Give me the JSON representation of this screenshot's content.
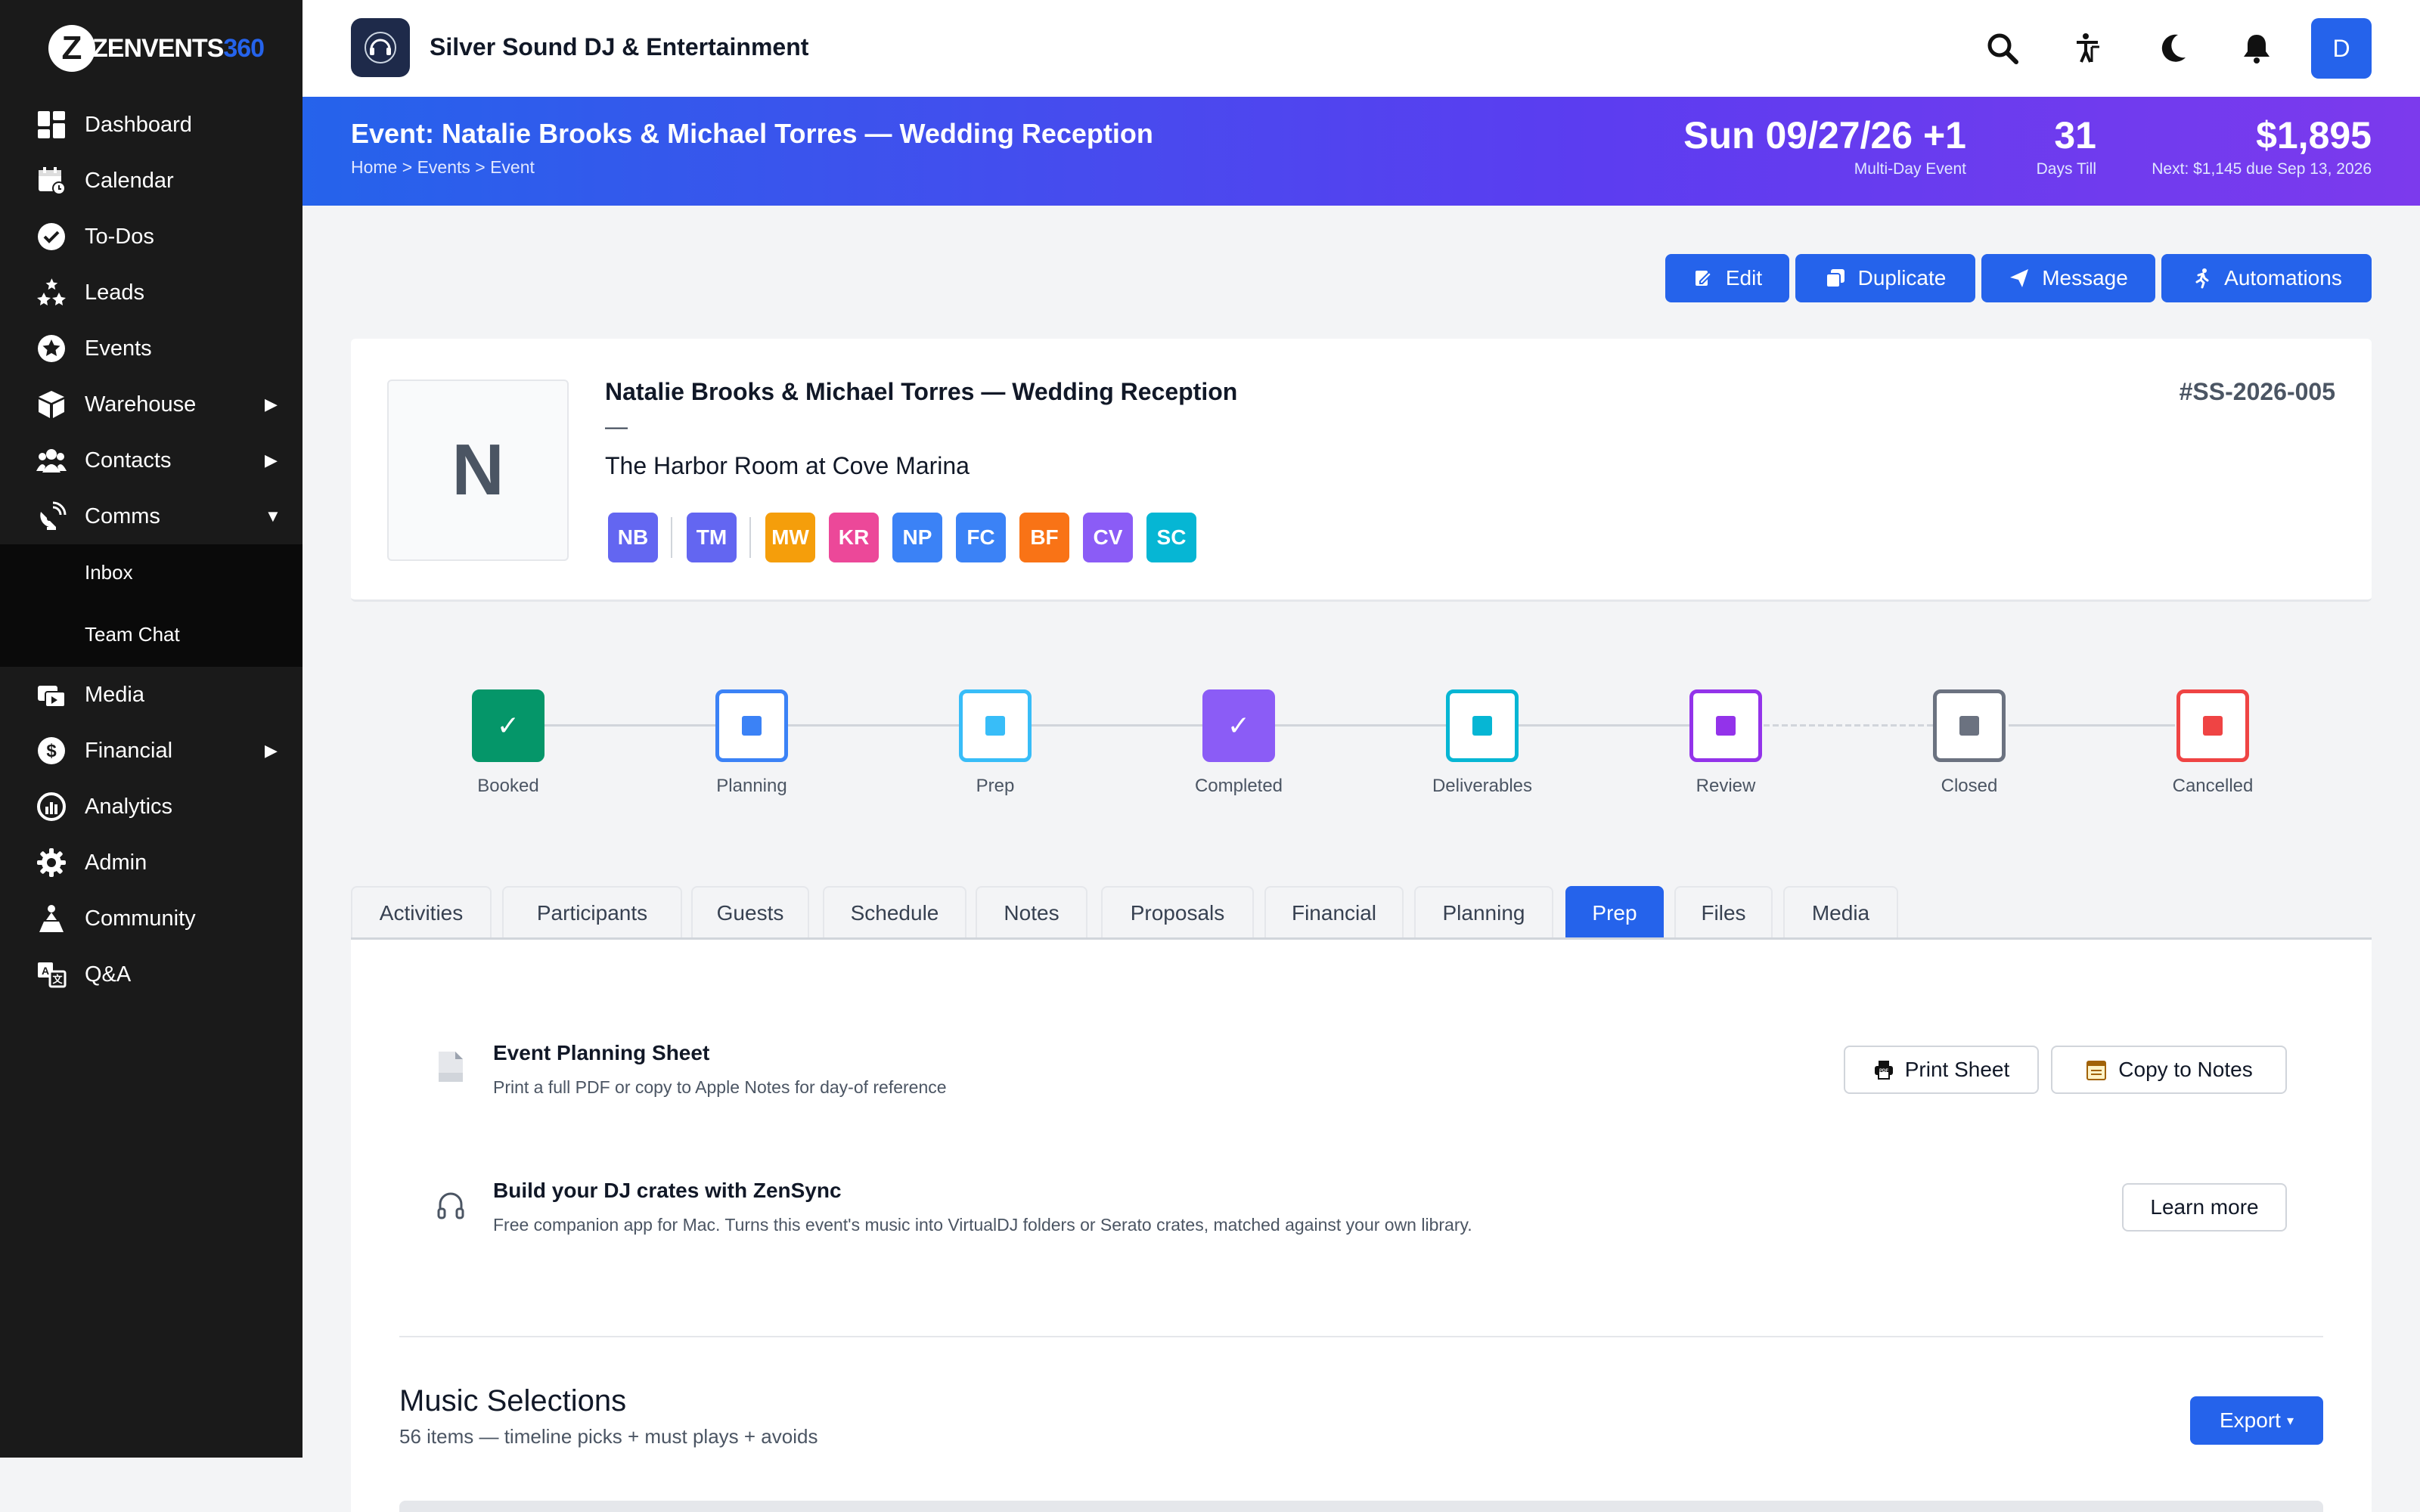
{
  "app": {
    "logo_letter": "Z",
    "logo_text": "ZENVENTS",
    "logo_accent": "360",
    "accent_color": "#2563eb"
  },
  "sidebar": {
    "items": [
      {
        "label": "Dashboard",
        "icon": "dashboard-icon"
      },
      {
        "label": "Calendar",
        "icon": "calendar-icon"
      },
      {
        "label": "To-Dos",
        "icon": "check-circle-icon"
      },
      {
        "label": "Leads",
        "icon": "stars-icon"
      },
      {
        "label": "Events",
        "icon": "star-circle-icon"
      },
      {
        "label": "Warehouse",
        "icon": "box-icon",
        "caret": "▶"
      },
      {
        "label": "Contacts",
        "icon": "users-icon",
        "caret": "▶"
      },
      {
        "label": "Comms",
        "icon": "satellite-icon",
        "caret": "▼"
      },
      {
        "label": "Media",
        "icon": "media-icon"
      },
      {
        "label": "Financial",
        "icon": "dollar-icon",
        "caret": "▶"
      },
      {
        "label": "Analytics",
        "icon": "chart-icon"
      },
      {
        "label": "Admin",
        "icon": "gear-icon"
      },
      {
        "label": "Community",
        "icon": "community-icon"
      },
      {
        "label": "Q&A",
        "icon": "translate-icon"
      }
    ],
    "sub_items": [
      {
        "label": "Inbox"
      },
      {
        "label": "Team Chat"
      }
    ]
  },
  "topbar": {
    "company_name": "Silver Sound DJ & Entertainment",
    "avatar_letter": "D",
    "icons": [
      "search-icon",
      "accessibility-icon",
      "moon-icon",
      "bell-icon"
    ]
  },
  "banner": {
    "title": "Event: Natalie Brooks & Michael Torres — Wedding Reception",
    "breadcrumb": "Home > Events > Event",
    "date": "Sun 09/27/26 +1",
    "date_label": "Multi-Day Event",
    "days_till": "31",
    "days_label": "Days Till",
    "amount": "$1,895",
    "next_payment": "Next: $1,145 due Sep 13, 2026"
  },
  "actions": [
    {
      "label": "Edit",
      "icon": "edit-icon"
    },
    {
      "label": "Duplicate",
      "icon": "duplicate-icon"
    },
    {
      "label": "Message",
      "icon": "send-icon"
    },
    {
      "label": "Automations",
      "icon": "run-icon"
    }
  ],
  "event": {
    "initial": "N",
    "title": "Natalie Brooks & Michael Torres — Wedding Reception",
    "dash": "—",
    "venue": "The Harbor Room at Cove Marina",
    "id": "#SS-2026-005",
    "chips": [
      {
        "label": "NB",
        "color": "#6366f1"
      },
      {
        "label": "TM",
        "color": "#6366f1"
      },
      {
        "label": "MW",
        "color": "#f59e0b"
      },
      {
        "label": "KR",
        "color": "#ec4899"
      },
      {
        "label": "NP",
        "color": "#3b82f6"
      },
      {
        "label": "FC",
        "color": "#3b82f6"
      },
      {
        "label": "BF",
        "color": "#f97316"
      },
      {
        "label": "CV",
        "color": "#8b5cf6"
      },
      {
        "label": "SC",
        "color": "#06b6d4"
      }
    ]
  },
  "pipeline": [
    {
      "label": "Booked",
      "color": "#059669",
      "state": "done"
    },
    {
      "label": "Planning",
      "color": "#3b82f6",
      "state": "todo"
    },
    {
      "label": "Prep",
      "color": "#38bdf8",
      "state": "todo"
    },
    {
      "label": "Completed",
      "color": "#8b5cf6",
      "state": "done"
    },
    {
      "label": "Deliverables",
      "color": "#06b6d4",
      "state": "todo"
    },
    {
      "label": "Review",
      "color": "#9333ea",
      "state": "todo"
    },
    {
      "label": "Closed",
      "color": "#6b7280",
      "state": "todo"
    },
    {
      "label": "Cancelled",
      "color": "#ef4444",
      "state": "todo"
    }
  ],
  "tabs": [
    {
      "label": "Activities"
    },
    {
      "label": "Participants"
    },
    {
      "label": "Guests"
    },
    {
      "label": "Schedule"
    },
    {
      "label": "Notes"
    },
    {
      "label": "Proposals"
    },
    {
      "label": "Financial"
    },
    {
      "label": "Planning"
    },
    {
      "label": "Prep",
      "active": true
    },
    {
      "label": "Files"
    },
    {
      "label": "Media"
    }
  ],
  "prep": {
    "sheet_title": "Event Planning Sheet",
    "sheet_sub": "Print a full PDF or copy to Apple Notes for day-of reference",
    "print_label": "Print Sheet",
    "copy_label": "Copy to Notes",
    "zensync_title": "Build your DJ crates with ZenSync",
    "zensync_sub": "Free companion app for Mac. Turns this event's music into VirtualDJ folders or Serato crates, matched against your own library.",
    "learn_label": "Learn more"
  },
  "music": {
    "title": "Music Selections",
    "subtitle": "56 items — timeline picks + must plays + avoids",
    "export_label": "Export",
    "export_caret": "▾"
  }
}
